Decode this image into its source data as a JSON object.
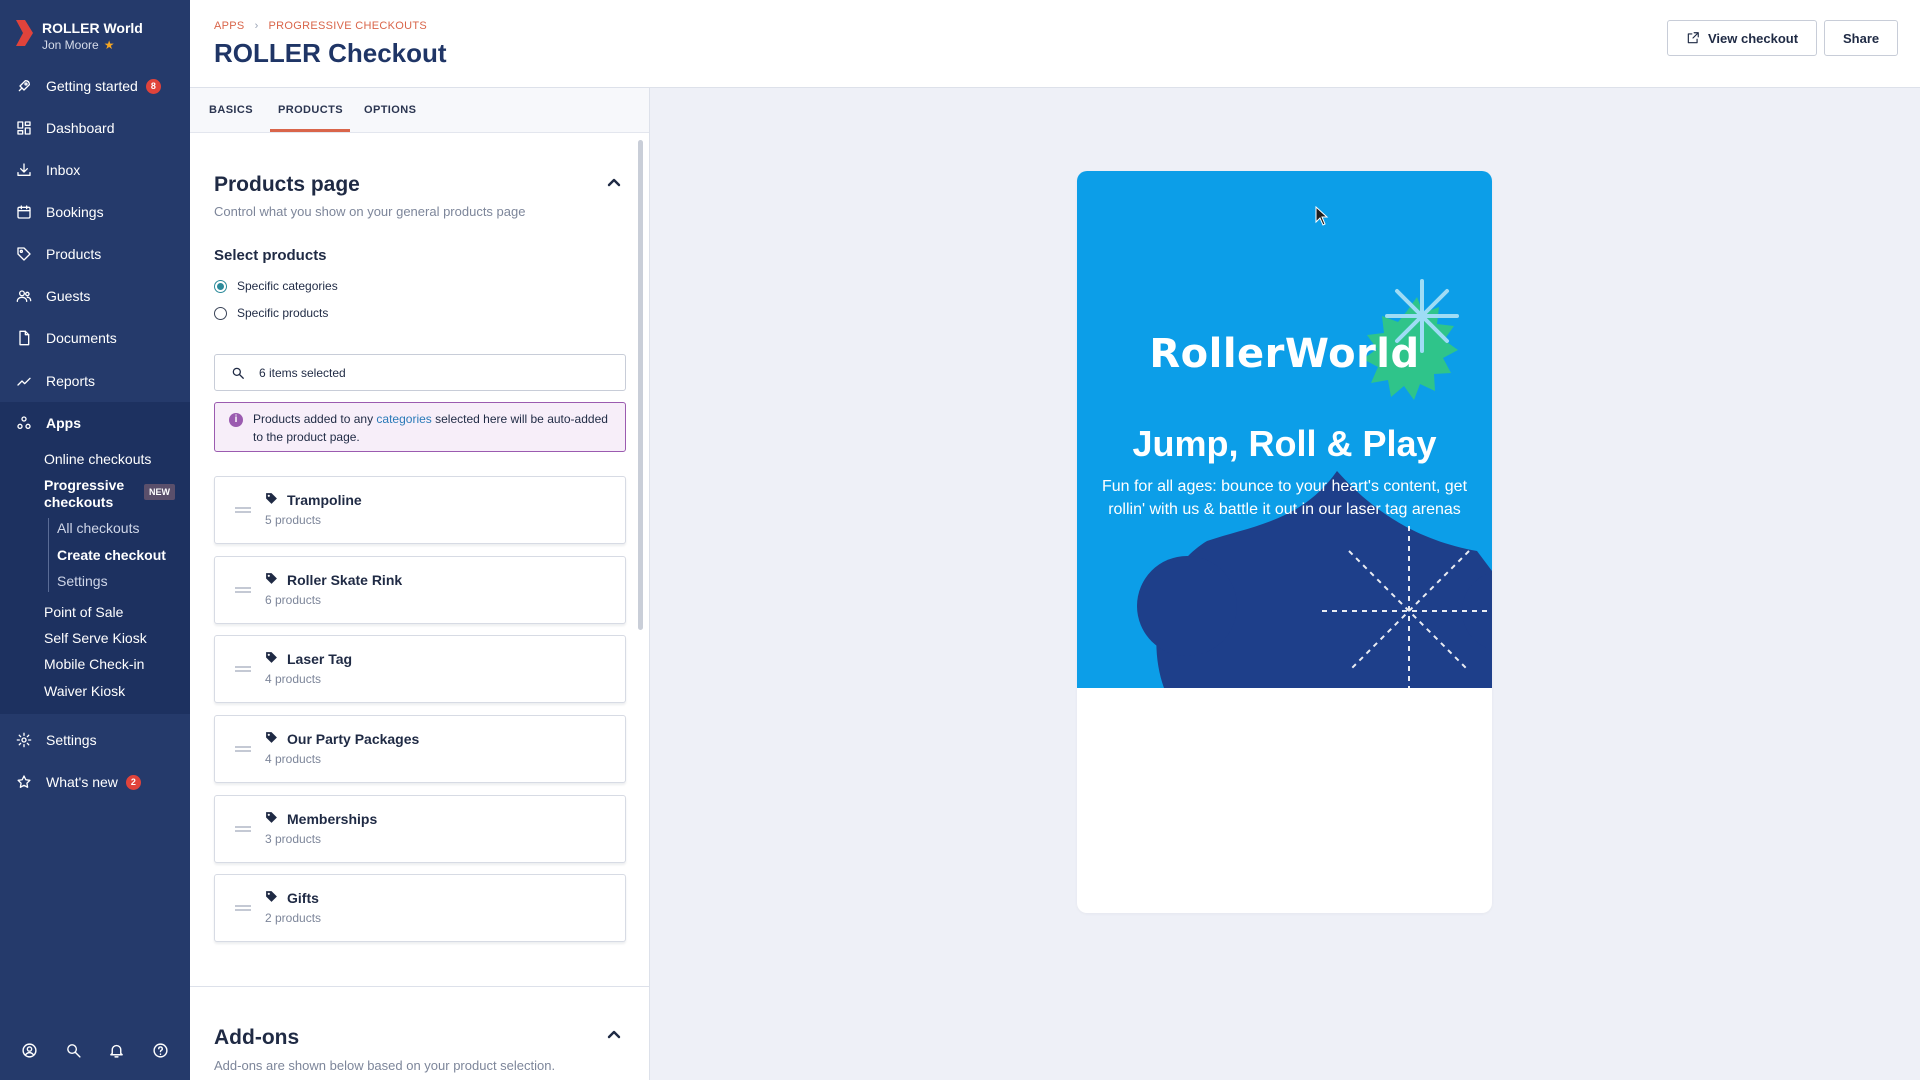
{
  "brand": {
    "name": "ROLLER World",
    "user": "Jon Moore"
  },
  "sidebar": {
    "items": [
      {
        "label": "Getting started",
        "icon": "rocket-icon",
        "badge": "8"
      },
      {
        "label": "Dashboard",
        "icon": "dashboard-icon"
      },
      {
        "label": "Inbox",
        "icon": "inbox-icon"
      },
      {
        "label": "Bookings",
        "icon": "calendar-icon"
      },
      {
        "label": "Products",
        "icon": "tag-icon"
      },
      {
        "label": "Guests",
        "icon": "guests-icon"
      },
      {
        "label": "Documents",
        "icon": "document-icon"
      },
      {
        "label": "Reports",
        "icon": "chart-icon"
      }
    ],
    "apps": {
      "label": "Apps",
      "children": [
        {
          "label": "Online checkouts"
        },
        {
          "label": "Progressive checkouts",
          "badge": "NEW"
        },
        {
          "label": "Point of Sale"
        },
        {
          "label": "Self Serve Kiosk"
        },
        {
          "label": "Mobile Check-in"
        },
        {
          "label": "Waiver Kiosk"
        }
      ],
      "progressive_children": [
        {
          "label": "All checkouts"
        },
        {
          "label": "Create checkout"
        },
        {
          "label": "Settings"
        }
      ]
    },
    "bottom_items": [
      {
        "label": "Settings",
        "icon": "gear-icon"
      },
      {
        "label": "What's new",
        "icon": "star-icon",
        "badge": "2"
      }
    ]
  },
  "header": {
    "breadcrumb": [
      "APPS",
      "PROGRESSIVE CHECKOUTS"
    ],
    "title": "ROLLER Checkout",
    "view_checkout": "View checkout",
    "share": "Share"
  },
  "tabs": [
    "BASICS",
    "PRODUCTS",
    "OPTIONS"
  ],
  "active_tab": "PRODUCTS",
  "products_page": {
    "title": "Products page",
    "subtitle": "Control what you show on your general products page",
    "select_label": "Select products",
    "options": [
      "Specific categories",
      "Specific products"
    ],
    "selected_option": "Specific categories",
    "search_value": "6 items selected",
    "info": {
      "before": "Products added to any ",
      "link": "categories",
      "after": " selected here will be auto-added to the product page."
    },
    "categories": [
      {
        "name": "Trampoline",
        "count": "5 products"
      },
      {
        "name": "Roller Skate Rink",
        "count": "6 products"
      },
      {
        "name": "Laser Tag",
        "count": "4 products"
      },
      {
        "name": "Our Party Packages",
        "count": "4 products"
      },
      {
        "name": "Memberships",
        "count": "3 products"
      },
      {
        "name": "Gifts",
        "count": "2 products"
      }
    ]
  },
  "addons": {
    "title": "Add-ons",
    "subtitle": "Add-ons are shown below based on your product selection."
  },
  "preview": {
    "logo": "RollerWorld",
    "title": "Jump, Roll & Play",
    "subtitle": "Fun for all ages: bounce to your heart's content, get rollin' with us & battle it out in our laser tag arenas"
  },
  "colors": {
    "sidebar": "#253a6b",
    "accent": "#d9654a",
    "hero": "#0c9ee8",
    "info_border": "#9b5bb0"
  }
}
